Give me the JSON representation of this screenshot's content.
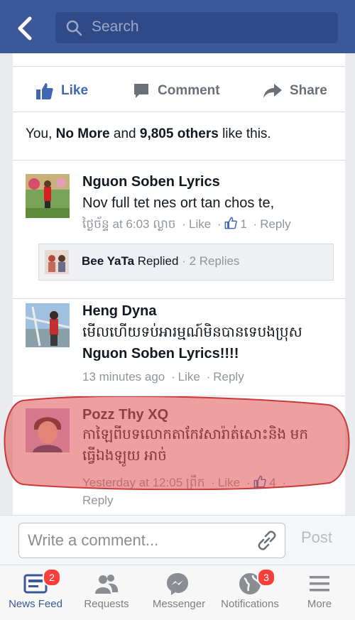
{
  "header": {
    "search_placeholder": "Search"
  },
  "post_actions": {
    "like": "Like",
    "comment": "Comment",
    "share": "Share"
  },
  "likes_summary": {
    "prefix": "You, ",
    "name": "No More",
    "middle": " and ",
    "others": "9,805 others",
    "suffix": " like this."
  },
  "comments": [
    {
      "author": "Nguon Soben Lyrics",
      "text": "Nov full tet nes ort tan chos te,",
      "time": "ថ្ងៃច័ន្ទ at 6:03 ល្ងាច",
      "like": "Like",
      "like_count": "1",
      "reply": "Reply",
      "replied_by": "Bee YaTa",
      "replied_label": "Replied",
      "replies_count": "2 Replies"
    },
    {
      "author": "Heng Dyna",
      "text_line1": "មើលហើយទប់អារម្មណ៍មិនបានទេបងប្រុស",
      "text_line2": "Nguon Soben Lyrics!!!!",
      "time": "13 minutes ago",
      "like": "Like",
      "reply": "Reply"
    },
    {
      "author": "Pozz Thy XQ",
      "text_line1": "កាឡៃពីបទលោកតាកែវសារ៉ាត់សោះនិង មក",
      "text_line2": "ធ្វើឯងឡូយ អាច់",
      "time": "Yesterday at 12:05 ព្រឹក",
      "like": "Like",
      "like_count": "4",
      "reply": "Reply"
    }
  ],
  "composer": {
    "placeholder": "Write a comment...",
    "post": "Post"
  },
  "tabs": [
    {
      "label": "News Feed",
      "badge": "2",
      "active": true
    },
    {
      "label": "Requests"
    },
    {
      "label": "Messenger"
    },
    {
      "label": "Notifications",
      "badge": "3"
    },
    {
      "label": "More"
    }
  ],
  "colors": {
    "brand": "#3b5998",
    "highlight": "#e05050",
    "badge": "#fa3e3e"
  }
}
